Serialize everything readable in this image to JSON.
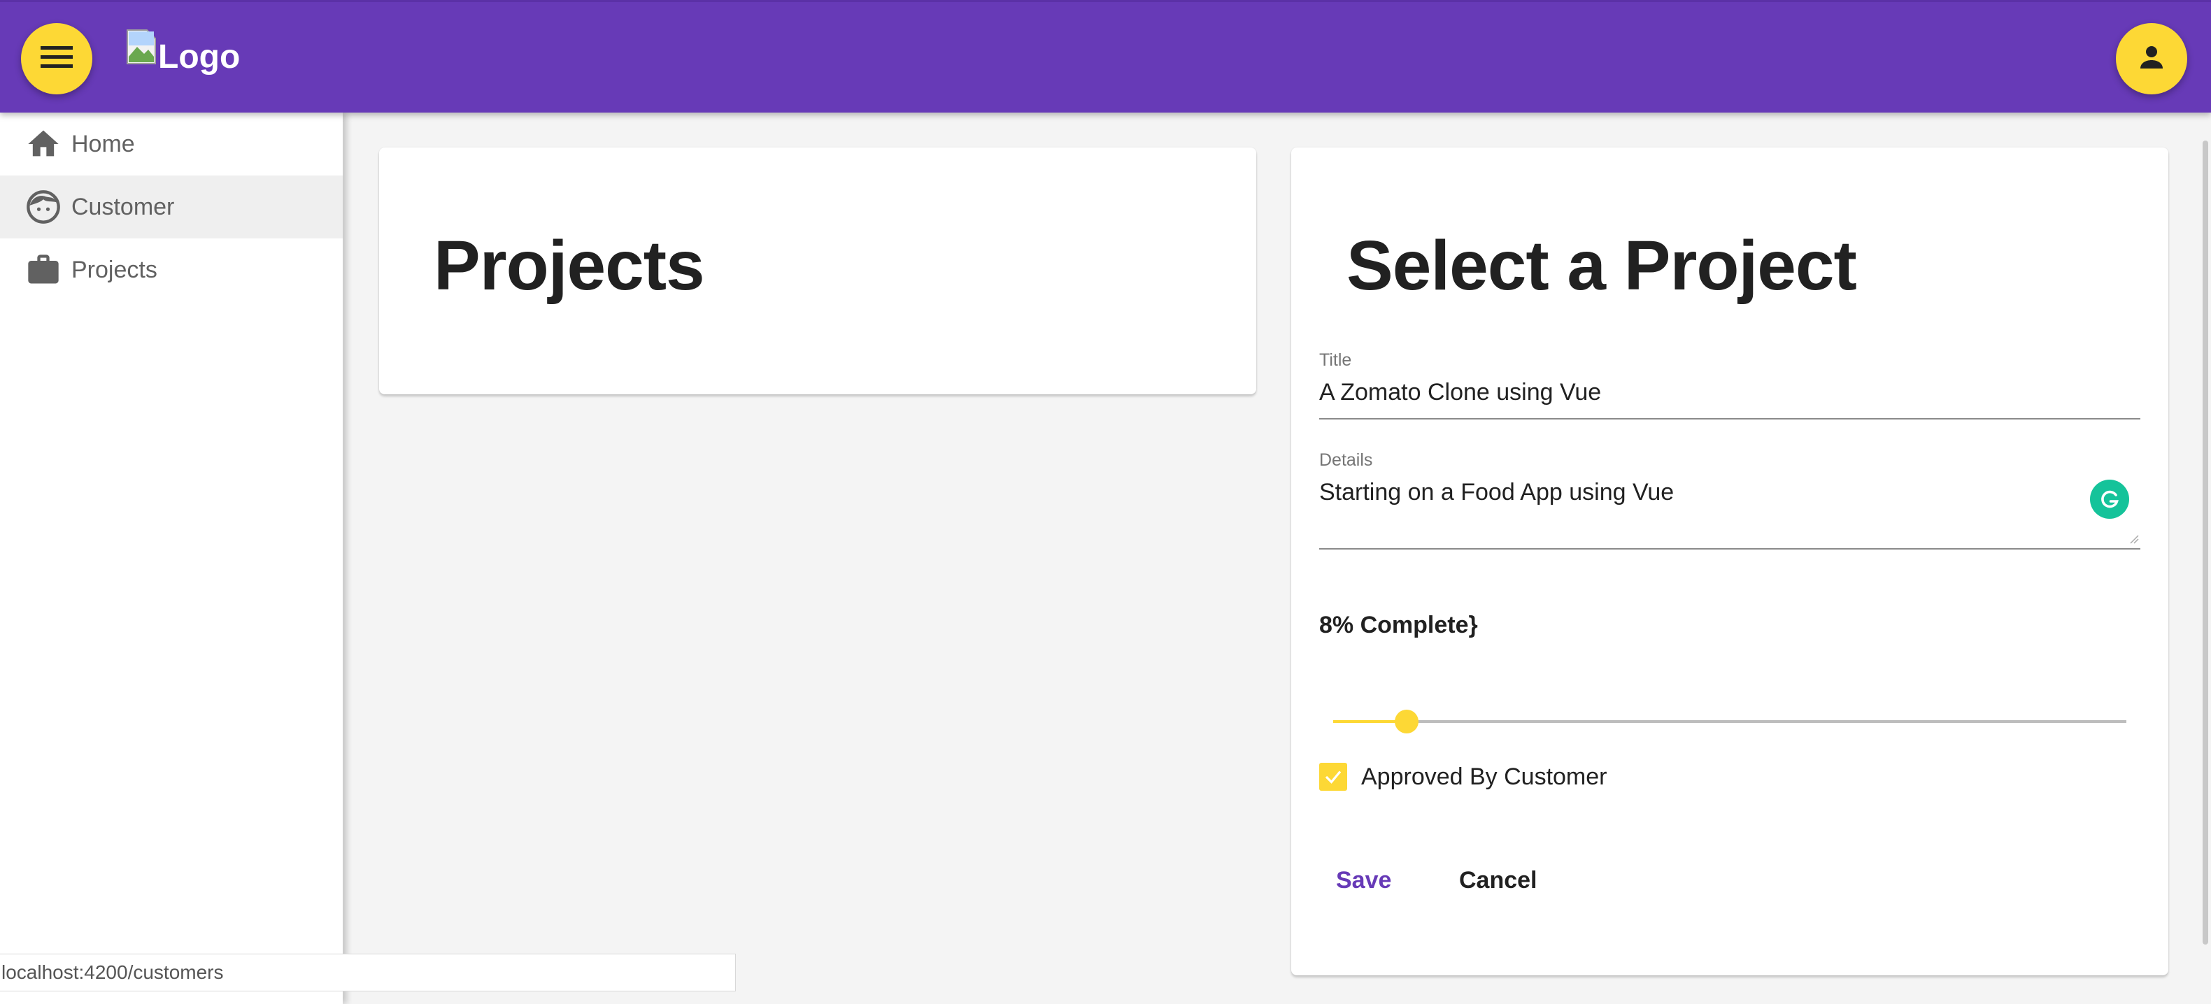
{
  "toolbar": {
    "logo_alt": "Logo",
    "menu_icon": "hamburger-menu-icon",
    "account_icon": "person-icon"
  },
  "sidebar": {
    "items": [
      {
        "label": "Home",
        "icon": "home-icon",
        "active": false
      },
      {
        "label": "Customer",
        "icon": "face-icon",
        "active": true
      },
      {
        "label": "Projects",
        "icon": "work-icon",
        "active": false
      }
    ]
  },
  "projects_panel": {
    "title": "Projects"
  },
  "detail_panel": {
    "title": "Select a Project",
    "title_field": {
      "label": "Title",
      "value": "A Zomato Clone using Vue"
    },
    "details_field": {
      "label": "Details",
      "value": "Starting on a Food App using Vue"
    },
    "progress": {
      "text": "8% Complete}",
      "value": 8
    },
    "approved_checkbox": {
      "label": "Approved By Customer",
      "checked": true
    },
    "save_label": "Save",
    "cancel_label": "Cancel"
  },
  "statusbar": {
    "url": "localhost:4200/customers"
  },
  "colors": {
    "primary": "#673ab7",
    "accent": "#fdd835",
    "grammarly": "#15c39a"
  }
}
